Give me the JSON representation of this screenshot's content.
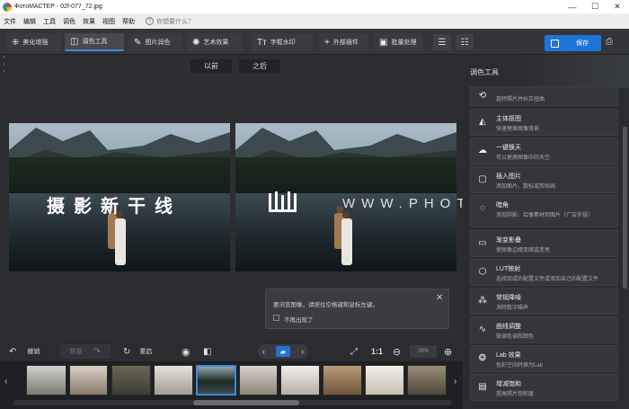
{
  "window": {
    "title": "ФотоМАСТЕР - 02f-077_72.jpg",
    "minimize": "—",
    "maximize": "☐",
    "close": "✕"
  },
  "menu": {
    "items": [
      "文件",
      "编辑",
      "工具",
      "调色",
      "效果",
      "视图",
      "帮助"
    ],
    "help_placeholder": "你想要什么？"
  },
  "toolbar": {
    "tabs": [
      {
        "label": "美化增强",
        "icon": "wand-icon"
      },
      {
        "label": "调色工具",
        "icon": "palette-icon"
      },
      {
        "label": "图片润色",
        "icon": "brush-icon"
      },
      {
        "label": "艺术效果",
        "icon": "sparkle-icon"
      },
      {
        "label": "字框水印",
        "icon": "text-icon"
      },
      {
        "label": "外部插件",
        "icon": "plus-icon"
      },
      {
        "label": "批量处理",
        "icon": "batch-icon"
      }
    ],
    "save_label": "保存"
  },
  "canvas": {
    "before_label": "以前",
    "after_label": "之后",
    "watermark_text": "摄影新干线",
    "watermark_url": "WWW.PHOTOSKS.VIP"
  },
  "hint": {
    "message": "要浏览图像，请按住空格键和鼠标左键。",
    "checkbox_label": "不再出现了"
  },
  "controls": {
    "undo_label": "撤销",
    "redo_label": "恢复",
    "reset_label": "重启",
    "ratio_label": "1:1",
    "zoom_value": "28%"
  },
  "filmstrip": {
    "thumb_count": 13,
    "selected_index": 5
  },
  "panel": {
    "title": "调色工具",
    "items": [
      {
        "title": "",
        "desc": "旋转照片并纠正扭曲",
        "icon": "rotate-icon"
      },
      {
        "title": "主体抠图",
        "desc": "快速替换图像背景",
        "icon": "bucket-icon"
      },
      {
        "title": "一键换天",
        "desc": "可以更换图像中的天空",
        "icon": "cloud-icon"
      },
      {
        "title": "插入图片",
        "desc": "添加图片、数标或剪贴画",
        "icon": "insert-icon"
      },
      {
        "title": "暗角",
        "desc": "添加阴影、绘像素材到图片（广告外链）",
        "icon": "vignette-icon"
      },
      {
        "title": "渐变影叠",
        "desc": "使图像边缘变暗或变亮",
        "icon": "gradient-icon"
      },
      {
        "title": "LUT映射",
        "desc": "选择现成的配置文件或添加自己的配置文件",
        "icon": "cube-icon"
      },
      {
        "title": "常规降噪",
        "desc": "消除数字噪声",
        "icon": "noise-icon"
      },
      {
        "title": "曲线调整",
        "desc": "微调色调和颜色",
        "icon": "curve-icon"
      },
      {
        "title": "Lab 效果",
        "desc": "色彩空间转换为Lab",
        "icon": "lab-icon"
      },
      {
        "title": "增减饱和",
        "desc": "提高照片饱和度",
        "icon": "saturation-icon"
      }
    ]
  },
  "colors": {
    "accent": "#1f74d8",
    "panel": "#2b2c30"
  }
}
